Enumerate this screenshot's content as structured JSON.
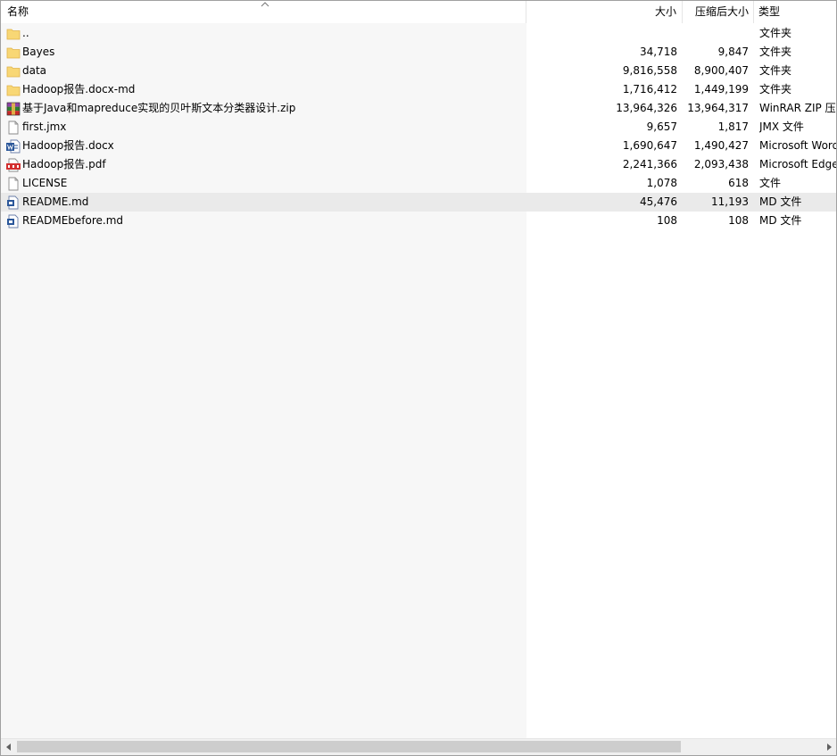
{
  "columns": {
    "name": "名称",
    "size": "大小",
    "packed": "压缩后大小",
    "type": "类型"
  },
  "files": [
    {
      "name": "..",
      "size": "",
      "packed": "",
      "type": "文件夹",
      "icon": "folder-icon",
      "selected": false
    },
    {
      "name": "Bayes",
      "size": "34,718",
      "packed": "9,847",
      "type": "文件夹",
      "icon": "folder-icon",
      "selected": false
    },
    {
      "name": "data",
      "size": "9,816,558",
      "packed": "8,900,407",
      "type": "文件夹",
      "icon": "folder-icon",
      "selected": false
    },
    {
      "name": "Hadoop报告.docx-md",
      "size": "1,716,412",
      "packed": "1,449,199",
      "type": "文件夹",
      "icon": "folder-icon",
      "selected": false
    },
    {
      "name": "基于Java和mapreduce实现的贝叶斯文本分类器设计.zip",
      "size": "13,964,326",
      "packed": "13,964,317",
      "type": "WinRAR ZIP 压缩文件",
      "icon": "winrar-archive-icon",
      "selected": false
    },
    {
      "name": "first.jmx",
      "size": "9,657",
      "packed": "1,817",
      "type": "JMX 文件",
      "icon": "file-icon",
      "selected": false
    },
    {
      "name": "Hadoop报告.docx",
      "size": "1,690,647",
      "packed": "1,490,427",
      "type": "Microsoft Word 文档",
      "icon": "word-document-icon",
      "selected": false
    },
    {
      "name": "Hadoop报告.pdf",
      "size": "2,241,366",
      "packed": "2,093,438",
      "type": "Microsoft Edge PDF 文档",
      "icon": "pdf-icon",
      "selected": false
    },
    {
      "name": "LICENSE",
      "size": "1,078",
      "packed": "618",
      "type": "文件",
      "icon": "file-icon",
      "selected": false
    },
    {
      "name": "README.md",
      "size": "45,476",
      "packed": "11,193",
      "type": "MD 文件",
      "icon": "md-file-icon",
      "selected": true
    },
    {
      "name": "READMEbefore.md",
      "size": "108",
      "packed": "108",
      "type": "MD 文件",
      "icon": "md-file-icon",
      "selected": false
    }
  ],
  "colors": {
    "folder": "#f8d775",
    "selected_row": "#eaeaea",
    "name_column_bg": "#f7f7f7",
    "pdf_red": "#d32f2f",
    "word_blue": "#2b579a"
  }
}
